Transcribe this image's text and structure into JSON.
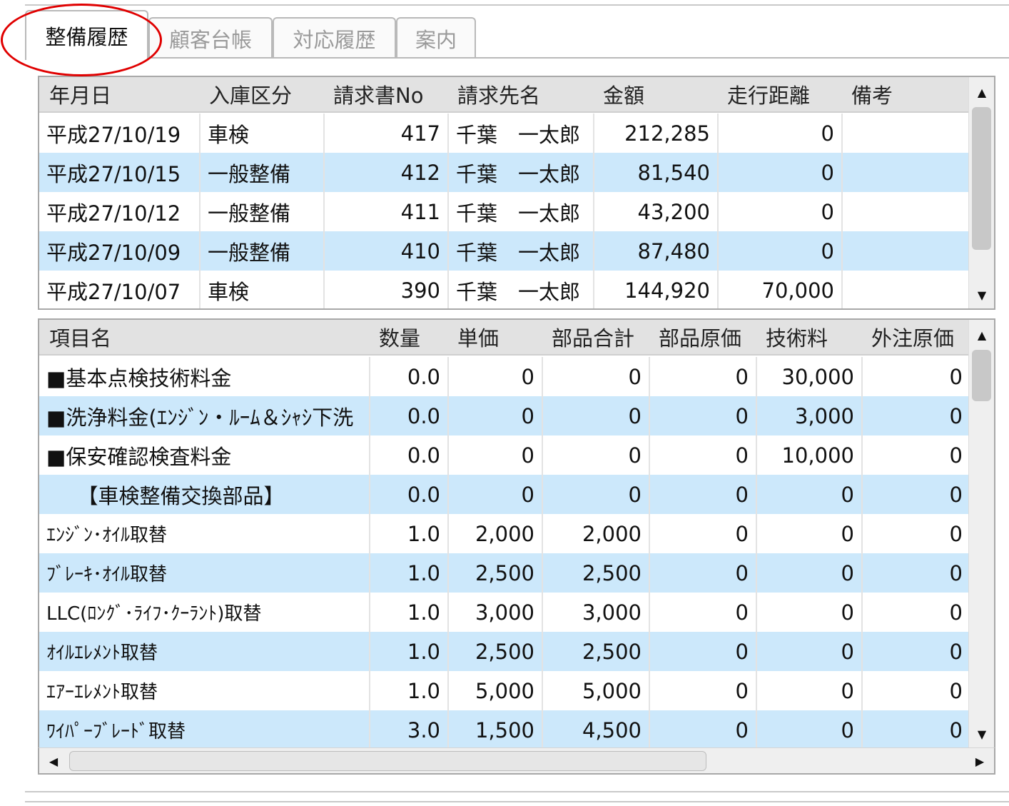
{
  "tabs": [
    {
      "label": "整備履歴",
      "active": true
    },
    {
      "label": "顧客台帳",
      "active": false
    },
    {
      "label": "対応履歴",
      "active": false
    },
    {
      "label": "案内",
      "active": false
    }
  ],
  "history": {
    "columns": [
      "年月日",
      "入庫区分",
      "請求書No",
      "請求先名",
      "金額",
      "走行距離",
      "備考"
    ],
    "rows": [
      [
        "平成27/10/19",
        "車検",
        "417",
        "千葉　一太郎",
        "212,285",
        "0",
        ""
      ],
      [
        "平成27/10/15",
        "一般整備",
        "412",
        "千葉　一太郎",
        "81,540",
        "0",
        ""
      ],
      [
        "平成27/10/12",
        "一般整備",
        "411",
        "千葉　一太郎",
        "43,200",
        "0",
        ""
      ],
      [
        "平成27/10/09",
        "一般整備",
        "410",
        "千葉　一太郎",
        "87,480",
        "0",
        ""
      ],
      [
        "平成27/10/07",
        "車検",
        "390",
        "千葉　一太郎",
        "144,920",
        "70,000",
        ""
      ]
    ]
  },
  "details": {
    "columns": [
      "項目名",
      "数量",
      "単価",
      "部品合計",
      "部品原価",
      "技術料",
      "外注原価"
    ],
    "rows": [
      [
        "■基本点検技術料金",
        "0.0",
        "0",
        "0",
        "0",
        "30,000",
        "0"
      ],
      [
        "■洗浄料金(ｴﾝｼﾞﾝ・ﾙｰﾑ＆ｼｬｼ下洗",
        "0.0",
        "0",
        "0",
        "0",
        "3,000",
        "0"
      ],
      [
        "■保安確認検査料金",
        "0.0",
        "0",
        "0",
        "0",
        "10,000",
        "0"
      ],
      [
        "　　【車検整備交換部品】",
        "0.0",
        "0",
        "0",
        "0",
        "0",
        "0"
      ],
      [
        "ｴﾝｼﾞﾝ･ｵｲﾙ取替",
        "1.0",
        "2,000",
        "2,000",
        "0",
        "0",
        "0"
      ],
      [
        "ﾌﾞﾚｰｷ･ｵｲﾙ取替",
        "1.0",
        "2,500",
        "2,500",
        "0",
        "0",
        "0"
      ],
      [
        "LLC(ﾛﾝｸﾞ･ﾗｲﾌ･ｸｰﾗﾝﾄ)取替",
        "1.0",
        "3,000",
        "3,000",
        "0",
        "0",
        "0"
      ],
      [
        "ｵｲﾙｴﾚﾒﾝﾄ取替",
        "1.0",
        "2,500",
        "2,500",
        "0",
        "0",
        "0"
      ],
      [
        "ｴｱｰｴﾚﾒﾝﾄ取替",
        "1.0",
        "5,000",
        "5,000",
        "0",
        "0",
        "0"
      ],
      [
        "ﾜｲﾊﾟｰﾌﾞﾚｰﾄﾞ取替",
        "3.0",
        "1,500",
        "4,500",
        "0",
        "0",
        "0"
      ]
    ]
  },
  "icons": {
    "scroll_up": "▲",
    "scroll_down": "▼",
    "scroll_left": "◀",
    "scroll_right": "▶"
  },
  "colors": {
    "alt_row": "#cce8fb",
    "header_bg": "#e2e2e2",
    "highlight": "#e00000"
  }
}
